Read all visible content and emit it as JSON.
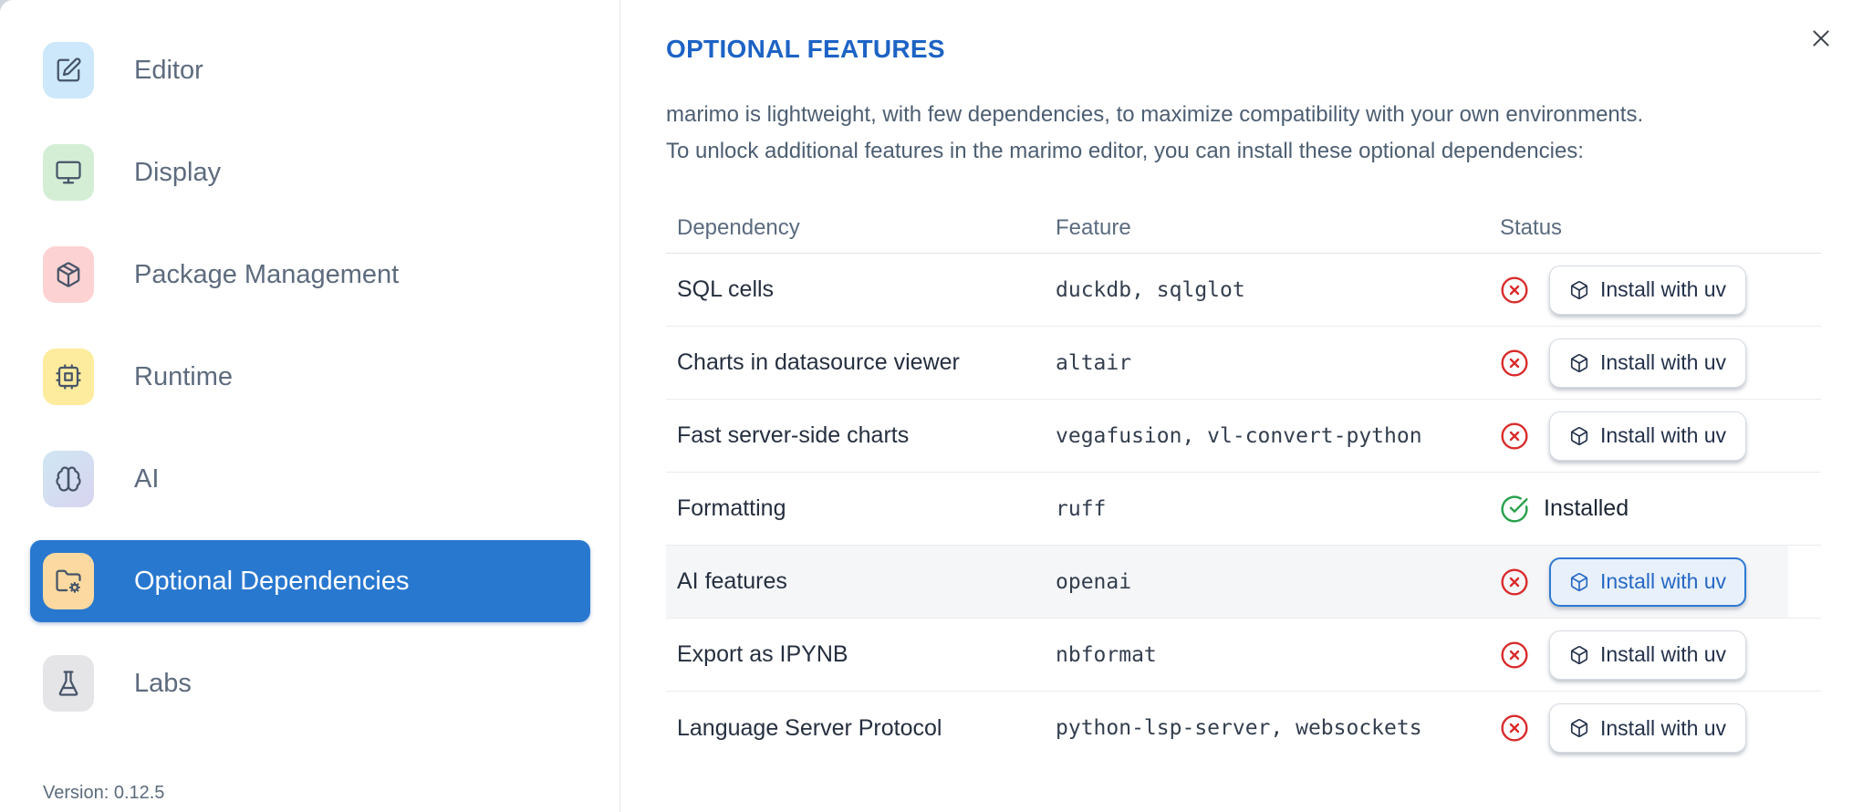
{
  "sidebar": {
    "items": [
      {
        "label": "Editor",
        "icon": "pencil-square-icon"
      },
      {
        "label": "Display",
        "icon": "monitor-icon"
      },
      {
        "label": "Package Management",
        "icon": "package-icon"
      },
      {
        "label": "Runtime",
        "icon": "cpu-icon"
      },
      {
        "label": "AI",
        "icon": "brain-icon"
      },
      {
        "label": "Optional Dependencies",
        "icon": "folder-gear-icon",
        "selected": true
      },
      {
        "label": "Labs",
        "icon": "flask-icon"
      }
    ],
    "version": "Version: 0.12.5"
  },
  "panel": {
    "title": "OPTIONAL FEATURES",
    "description_lines": [
      "marimo is lightweight, with few dependencies, to maximize compatibility with your own environments.",
      "To unlock additional features in the marimo editor, you can install these optional dependencies:"
    ]
  },
  "table": {
    "columns": [
      "Dependency",
      "Feature",
      "Status"
    ],
    "rows": [
      {
        "dependency": "SQL cells",
        "feature": "duckdb, sqlglot",
        "status": "not-installed",
        "action_label": "Install with uv"
      },
      {
        "dependency": "Charts in datasource viewer",
        "feature": "altair",
        "status": "not-installed",
        "action_label": "Install with uv"
      },
      {
        "dependency": "Fast server-side charts",
        "feature": "vegafusion, vl-convert-python",
        "status": "not-installed",
        "action_label": "Install with uv"
      },
      {
        "dependency": "Formatting",
        "feature": "ruff",
        "status": "installed",
        "status_label": "Installed"
      },
      {
        "dependency": "AI features",
        "feature": "openai",
        "status": "not-installed",
        "action_label": "Install with uv",
        "highlighted": true
      },
      {
        "dependency": "Export as IPYNB",
        "feature": "nbformat",
        "status": "not-installed",
        "action_label": "Install with uv"
      },
      {
        "dependency": "Language Server Protocol",
        "feature": "python-lsp-server, websockets",
        "status": "not-installed",
        "action_label": "Install with uv"
      }
    ]
  },
  "colors": {
    "accent_blue": "#2878d0",
    "heading_blue": "#1d63c5",
    "status_red": "#d92b2b",
    "status_green": "#27a04a"
  }
}
